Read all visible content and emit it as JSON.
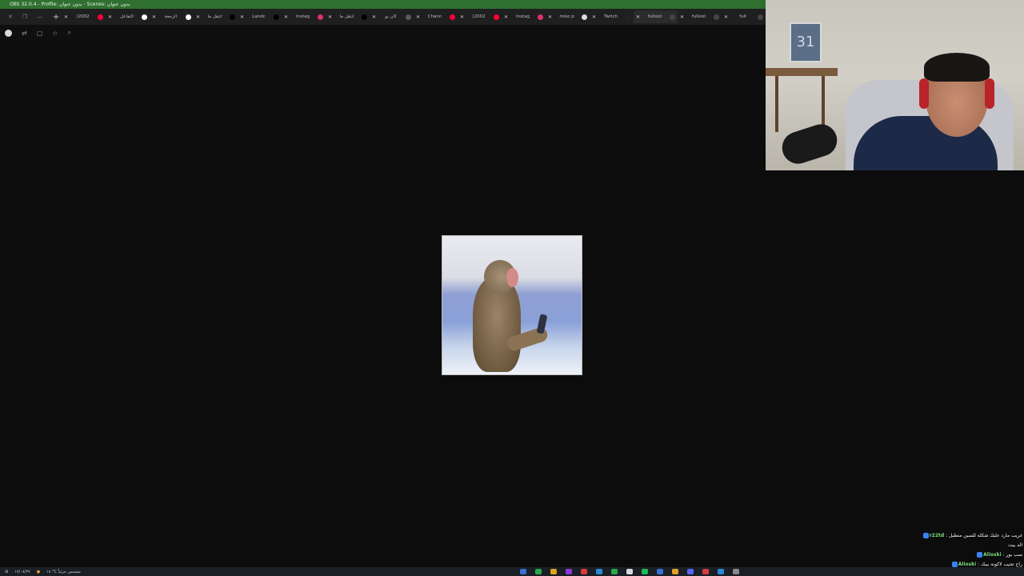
{
  "obs": {
    "title": "OBS 32.0.4 - Profile: بدون عنوان - Scenes: بدون عنوان"
  },
  "browser": {
    "new_tab_label": "+",
    "tabs": [
      {
        "label": "(2002",
        "favicon_color": "#ff0033"
      },
      {
        "label": "التفاعل",
        "favicon_color": "#ffffff"
      },
      {
        "label": "الرجعة",
        "favicon_color": "#ffffff"
      },
      {
        "label": "انتقل ما",
        "favicon_color": "#000000"
      },
      {
        "label": "Landc",
        "favicon_color": "#000000"
      },
      {
        "label": "Instag",
        "favicon_color": "#e1306c"
      },
      {
        "label": "انتقل ما",
        "favicon_color": "#000000"
      },
      {
        "label": "كان يو",
        "favicon_color": "#5a5a5a"
      },
      {
        "label": "Chann",
        "favicon_color": "#ff0033"
      },
      {
        "label": "(2002",
        "favicon_color": "#ff0033"
      },
      {
        "label": "Instag",
        "favicon_color": "#e1306c"
      },
      {
        "label": "miso p",
        "favicon_color": "#dcdcdc"
      },
      {
        "label": "Twitch",
        "favicon_color": "#222222"
      },
      {
        "label": "fullsizi",
        "favicon_color": "#444444",
        "active": true
      },
      {
        "label": "fullsizi",
        "favicon_color": "#444444"
      },
      {
        "label": "full",
        "favicon_color": "#444444"
      }
    ],
    "toolbar_icons": [
      "avatar-icon",
      "translate-icon",
      "extension-icon",
      "star-icon",
      "zoom-icon"
    ]
  },
  "chat": [
    {
      "user": "r22td",
      "message": "غريب مارد عليك شكله للسين متطيل",
      "user_color": "#7ee07e"
    },
    {
      "user": "",
      "message": "اله بيت",
      "user_color": "#ffffff"
    },
    {
      "user": "Alioski",
      "message": "سب بور",
      "user_color": "#7ee07e"
    },
    {
      "user": "Alioski",
      "message": "راح تجيب لاكونة بيبك",
      "user_color": "#7ee07e"
    }
  ],
  "taskbar": {
    "date": "١٧/٠٨/٢٧",
    "weather": "١٨ °C مشمس جزئياً"
  }
}
